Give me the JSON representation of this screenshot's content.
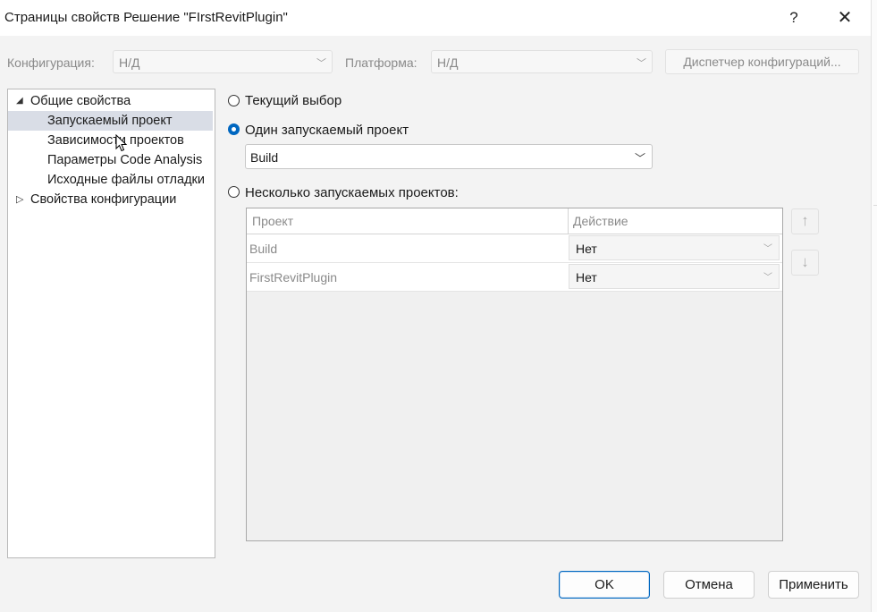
{
  "window": {
    "title": "Страницы свойств Решение \"FIrstRevitPlugin\"",
    "help_label": "?",
    "close_label": "✕"
  },
  "toolbar": {
    "configuration_label": "Конфигурация:",
    "configuration_value": "Н/Д",
    "platform_label": "Платформа:",
    "platform_value": "Н/Д",
    "config_manager_label": "Диспетчер конфигураций..."
  },
  "tree": {
    "items": [
      {
        "label": "Общие свойства",
        "expanded": true
      },
      {
        "label": "Запускаемый проект",
        "selected": true
      },
      {
        "label": "Зависимости проектов"
      },
      {
        "label": "Параметры Code Analysis"
      },
      {
        "label": "Исходные файлы отладки"
      },
      {
        "label": "Свойства конфигурации",
        "expanded": false
      }
    ]
  },
  "startup": {
    "current_selection_label": "Текущий выбор",
    "single_label": "Один запускаемый проект",
    "single_value": "Build",
    "multiple_label": "Несколько запускаемых проектов:",
    "selected_option": "single"
  },
  "grid": {
    "col_project": "Проект",
    "col_action": "Действие",
    "rows": [
      {
        "project": "Build",
        "action": "Нет"
      },
      {
        "project": "FirstRevitPlugin",
        "action": "Нет"
      }
    ],
    "move_up_icon": "arrow-up-icon",
    "move_down_icon": "arrow-down-icon"
  },
  "buttons": {
    "ok": "OK",
    "cancel": "Отмена",
    "apply": "Применить"
  },
  "colors": {
    "accent": "#0067c0",
    "selection": "#d9dde6"
  }
}
